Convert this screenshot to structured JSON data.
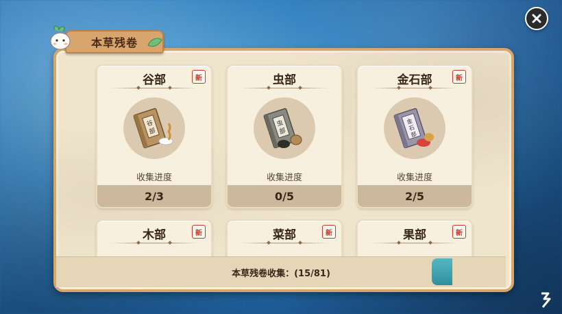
{
  "title": "本草残卷",
  "new_badge_text": "新",
  "progress_label": "收集进度",
  "cards": [
    {
      "name": "谷部",
      "progress": "2/3",
      "is_new": true,
      "book_label": "谷部"
    },
    {
      "name": "虫部",
      "progress": "0/5",
      "is_new": false,
      "book_label": "虫部"
    },
    {
      "name": "金石部",
      "progress": "2/5",
      "is_new": true,
      "book_label": "金石部"
    },
    {
      "name": "木部",
      "is_new": true
    },
    {
      "name": "菜部",
      "is_new": true
    },
    {
      "name": "果部",
      "is_new": true
    }
  ],
  "footer": {
    "collection_text": "本草残卷收集：(15/81)"
  },
  "colors": {
    "panel_border": "#d7a66a",
    "panel_bg": "#efe4cc",
    "new_badge": "#c23a2b"
  },
  "icons": {
    "close": "close-icon",
    "mascot": "radish-mascot-icon",
    "watermark": "jiuyou-logo"
  }
}
